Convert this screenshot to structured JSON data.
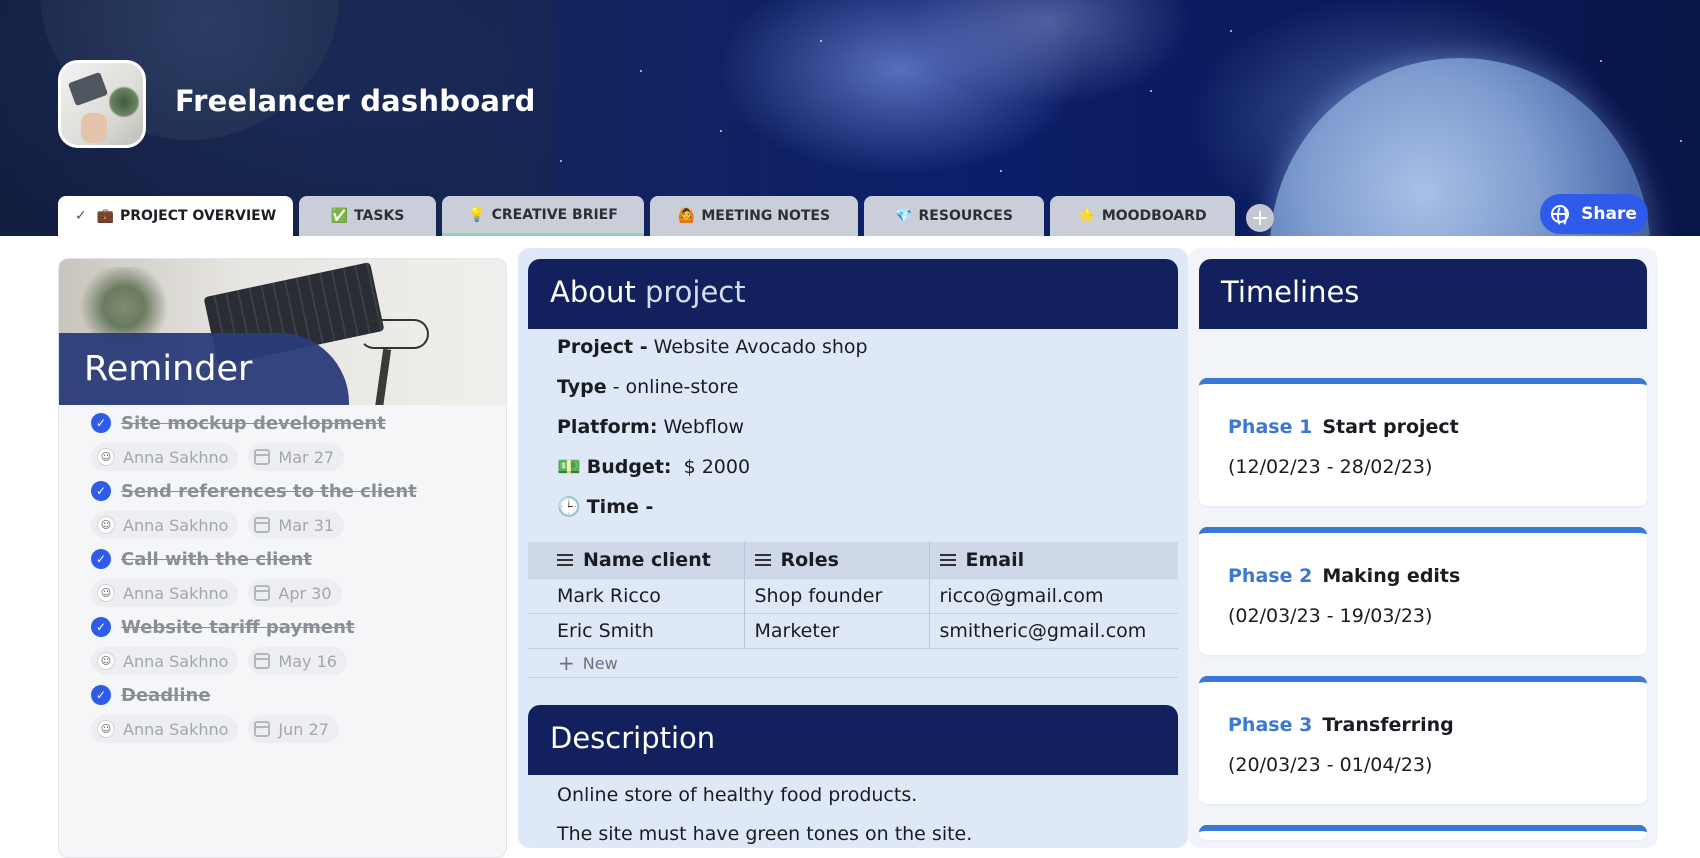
{
  "header": {
    "title": "Freelancer dashboard",
    "share_label": "Share"
  },
  "tabs": [
    {
      "icon": "💼",
      "label": "PROJECT OVERVIEW",
      "active": true
    },
    {
      "icon": "✅",
      "label": "TASKS"
    },
    {
      "icon": "💡",
      "label": "CREATIVE BRIEF"
    },
    {
      "icon": "🙆",
      "label": "MEETING NOTES"
    },
    {
      "icon": "💎",
      "label": "RESOURCES"
    },
    {
      "icon": "⭐",
      "label": "MOODBOARD"
    }
  ],
  "reminder": {
    "title": "Reminder",
    "items": [
      {
        "task": "Site mockup development",
        "assignee": "Anna Sakhno",
        "date": "Mar 27"
      },
      {
        "task": "Send references to the client",
        "assignee": "Anna Sakhno",
        "date": "Mar 31"
      },
      {
        "task": "Call with the client",
        "assignee": "Anna Sakhno",
        "date": "Apr 30"
      },
      {
        "task": "Website tariff payment",
        "assignee": "Anna Sakhno",
        "date": "May 16"
      },
      {
        "task": "Deadline",
        "assignee": "Anna Sakhno",
        "date": "Jun 27"
      }
    ]
  },
  "about": {
    "heading_bold": "About",
    "heading_light": "project",
    "project_label": "Project -",
    "project_value": "Website Avocado shop",
    "type_label": "Type",
    "type_value": "- online-store",
    "platform_label": "Platform:",
    "platform_value": "Webflow",
    "budget_icon": "💵",
    "budget_label": "Budget:",
    "budget_value": "$ 2000",
    "time_icon": "🕒",
    "time_label": "Time -",
    "table": {
      "headers": [
        "Name client",
        "Roles",
        "Email"
      ],
      "rows": [
        [
          "Mark Ricco",
          "Shop founder",
          "ricco@gmail.com"
        ],
        [
          "Eric Smith",
          "Marketer",
          "smitheric@gmail.com"
        ]
      ],
      "new_label": "New"
    }
  },
  "description": {
    "heading": "Description",
    "lines": [
      "Online store of healthy food products.",
      "The site must have green tones on the site."
    ]
  },
  "timelines": {
    "heading": "Timelines",
    "phases": [
      {
        "num": "Phase 1",
        "name": "Start project",
        "dates": "(12/02/23 - 28/02/23)"
      },
      {
        "num": "Phase 2",
        "name": "Making edits",
        "dates": "(02/03/23 - 19/03/23)"
      },
      {
        "num": "Phase 3",
        "name": "Transferring",
        "dates": "(20/03/23 - 01/04/23)"
      }
    ]
  },
  "colors": {
    "navy": "#12215e",
    "accent_blue": "#2f5bea",
    "phase_blue": "#3a78d6"
  }
}
